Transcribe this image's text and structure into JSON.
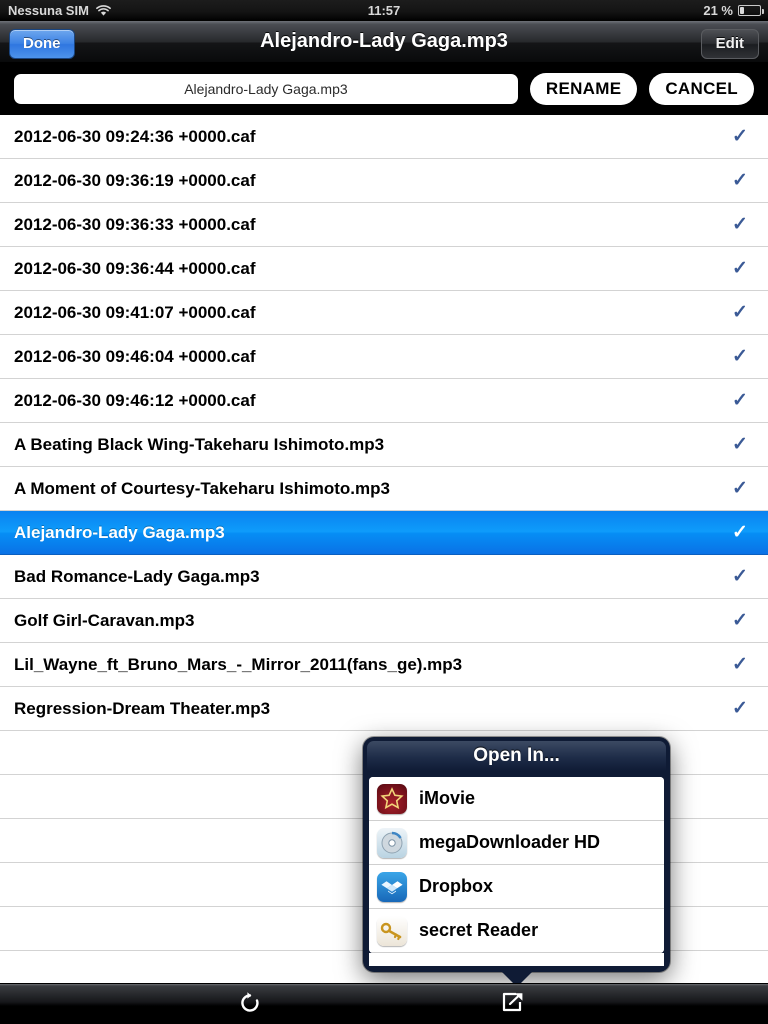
{
  "status_bar": {
    "carrier": "Nessuna SIM",
    "wifi_icon": "wifi-icon",
    "time": "11:57",
    "battery_percent": "21 %",
    "battery_icon": "battery-icon",
    "battery_level": 21
  },
  "nav_bar": {
    "done_label": "Done",
    "title": "Alejandro-Lady Gaga.mp3",
    "edit_label": "Edit"
  },
  "rename_bar": {
    "field_value": "Alejandro-Lady Gaga.mp3",
    "field_placeholder": "Alejandro-Lady Gaga.mp3",
    "rename_label": "RENAME",
    "cancel_label": "CANCEL"
  },
  "file_list": {
    "check_color": "#3b5a96",
    "selected_color": "#0a8df5",
    "check_glyph": "✓",
    "empty_row_count": 6,
    "rows": [
      {
        "name": "2012-06-30 09:24:36 +0000.caf",
        "checked": true,
        "selected": false
      },
      {
        "name": "2012-06-30 09:36:19 +0000.caf",
        "checked": true,
        "selected": false
      },
      {
        "name": "2012-06-30 09:36:33 +0000.caf",
        "checked": true,
        "selected": false
      },
      {
        "name": "2012-06-30 09:36:44 +0000.caf",
        "checked": true,
        "selected": false
      },
      {
        "name": "2012-06-30 09:41:07 +0000.caf",
        "checked": true,
        "selected": false
      },
      {
        "name": "2012-06-30 09:46:04 +0000.caf",
        "checked": true,
        "selected": false
      },
      {
        "name": "2012-06-30 09:46:12 +0000.caf",
        "checked": true,
        "selected": false
      },
      {
        "name": "A Beating Black Wing-Takeharu Ishimoto.mp3",
        "checked": true,
        "selected": false
      },
      {
        "name": "A Moment of Courtesy-Takeharu Ishimoto.mp3",
        "checked": true,
        "selected": false
      },
      {
        "name": "Alejandro-Lady Gaga.mp3",
        "checked": true,
        "selected": true
      },
      {
        "name": "Bad Romance-Lady Gaga.mp3",
        "checked": true,
        "selected": false
      },
      {
        "name": "Golf Girl-Caravan.mp3",
        "checked": true,
        "selected": false
      },
      {
        "name": "Lil_Wayne_ft_Bruno_Mars_-_Mirror_2011(fans_ge).mp3",
        "checked": true,
        "selected": false
      },
      {
        "name": "Regression-Dream Theater.mp3",
        "checked": true,
        "selected": false
      }
    ]
  },
  "popover": {
    "title": "Open In...",
    "items": [
      {
        "label": "iMovie",
        "icon": "imovie-app-icon"
      },
      {
        "label": "megaDownloader HD",
        "icon": "megadownloader-app-icon"
      },
      {
        "label": "Dropbox",
        "icon": "dropbox-app-icon"
      },
      {
        "label": "secret Reader",
        "icon": "secret-reader-app-icon"
      }
    ]
  },
  "toolbar": {
    "refresh_icon": "refresh-icon",
    "share_icon": "share-icon"
  }
}
